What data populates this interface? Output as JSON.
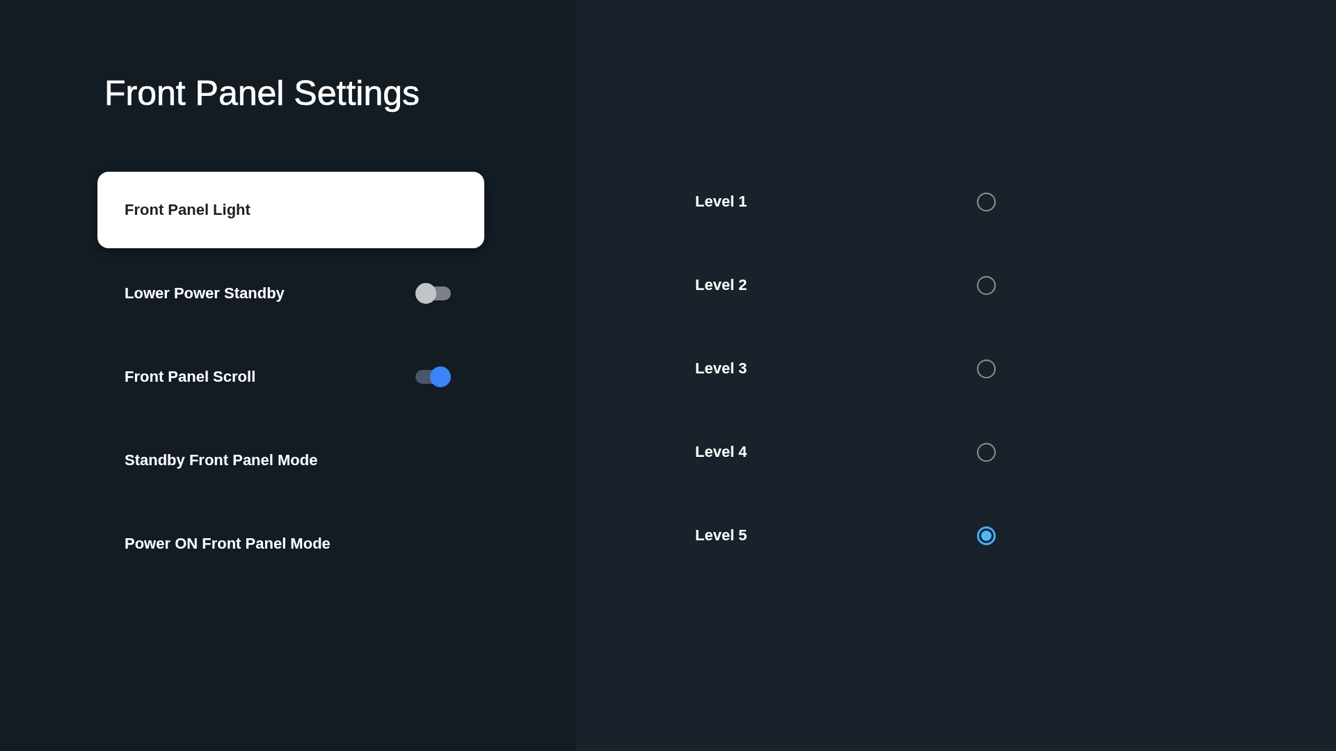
{
  "title": "Front Panel Settings",
  "menu": [
    {
      "label": "Front Panel Light",
      "kind": "item",
      "selected": true
    },
    {
      "label": "Lower Power Standby",
      "kind": "toggle",
      "selected": false,
      "on": false
    },
    {
      "label": "Front Panel Scroll",
      "kind": "toggle",
      "selected": false,
      "on": true
    },
    {
      "label": "Standby Front Panel Mode",
      "kind": "item",
      "selected": false
    },
    {
      "label": "Power ON Front Panel Mode",
      "kind": "item",
      "selected": false
    }
  ],
  "options": [
    {
      "label": "Level 1",
      "selected": false
    },
    {
      "label": "Level 2",
      "selected": false
    },
    {
      "label": "Level 3",
      "selected": false
    },
    {
      "label": "Level 4",
      "selected": false
    },
    {
      "label": "Level 5",
      "selected": true
    }
  ]
}
